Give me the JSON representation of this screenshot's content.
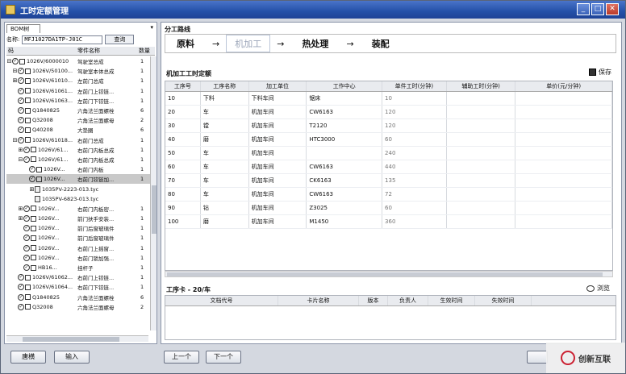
{
  "window": {
    "title": "工时定额管理"
  },
  "left": {
    "tab_label": "BOM树",
    "name_label": "名称:",
    "name_value": "MFJ1027DA1TP-J01C",
    "query_label": "查询",
    "col_code": "码",
    "col_name": "零件名称",
    "col_qty": "数量",
    "tree": [
      {
        "toggle": "⊟",
        "code": "1026V/6000010",
        "name": "驾驶室总成",
        "qty": "1",
        "indent": 0
      },
      {
        "toggle": "⊟",
        "code": "1026V/50100...",
        "name": "驾驶室本体总成",
        "qty": "1",
        "indent": 1
      },
      {
        "toggle": "⊞",
        "code": "1026V/61010...",
        "name": "左前门总成",
        "qty": "1",
        "indent": 1
      },
      {
        "toggle": "",
        "code": "1026V/61061...",
        "name": "左前门上铰链...",
        "qty": "1",
        "indent": 1
      },
      {
        "toggle": "",
        "code": "1026V/61063...",
        "name": "左前门下铰链...",
        "qty": "1",
        "indent": 1
      },
      {
        "toggle": "",
        "code": "Q1840825",
        "name": "六角法兰面螺栓",
        "qty": "6",
        "indent": 1
      },
      {
        "toggle": "",
        "code": "Q32008",
        "name": "六角法兰面螺母",
        "qty": "2",
        "indent": 1
      },
      {
        "toggle": "",
        "code": "Q40208",
        "name": "大垫圈",
        "qty": "6",
        "indent": 1
      },
      {
        "toggle": "⊟",
        "code": "1026V/61018...",
        "name": "右前门总成",
        "qty": "1",
        "indent": 1
      },
      {
        "toggle": "⊞",
        "code": "1026V/61...",
        "name": "右前门内板总成",
        "qty": "1",
        "indent": 2
      },
      {
        "toggle": "⊟",
        "code": "1026V/61...",
        "name": "右前门内板总成",
        "qty": "1",
        "indent": 2
      },
      {
        "toggle": "",
        "code": "1026V...",
        "name": "右前门内板",
        "qty": "1",
        "indent": 3
      },
      {
        "toggle": "",
        "code": "1026V...",
        "name": "右前门铰链加...",
        "qty": "1",
        "indent": 3,
        "selected": true
      },
      {
        "toggle": "⊞",
        "code": "1035PV-2223-013.tyc",
        "name": "",
        "qty": "",
        "indent": 4,
        "doc": true
      },
      {
        "toggle": "",
        "code": "1035PV-6823-013.tyc",
        "name": "",
        "qty": "",
        "indent": 4,
        "doc": true
      },
      {
        "toggle": "⊞",
        "code": "1026V...",
        "name": "右前门内板密...",
        "qty": "1",
        "indent": 2
      },
      {
        "toggle": "⊞",
        "code": "1026V...",
        "name": "前门扶手安装...",
        "qty": "1",
        "indent": 2
      },
      {
        "toggle": "",
        "code": "1026V...",
        "name": "前门后窗玻璃件",
        "qty": "1",
        "indent": 2
      },
      {
        "toggle": "",
        "code": "1026V...",
        "name": "前门后窗玻璃件",
        "qty": "1",
        "indent": 2
      },
      {
        "toggle": "",
        "code": "1026V...",
        "name": "右前门上摇窗...",
        "qty": "1",
        "indent": 2
      },
      {
        "toggle": "",
        "code": "1026V...",
        "name": "右前门锁加强...",
        "qty": "1",
        "indent": 2
      },
      {
        "toggle": "",
        "code": "HB16...",
        "name": "挂杆子",
        "qty": "1",
        "indent": 2
      },
      {
        "toggle": "",
        "code": "1026V/61062...",
        "name": "右前门上铰链...",
        "qty": "1",
        "indent": 1
      },
      {
        "toggle": "",
        "code": "1026V/61064...",
        "name": "右前门下铰链...",
        "qty": "1",
        "indent": 1
      },
      {
        "toggle": "",
        "code": "Q1840825",
        "name": "六角法兰面螺栓",
        "qty": "6",
        "indent": 1
      },
      {
        "toggle": "",
        "code": "Q32008",
        "name": "六角法兰面螺母",
        "qty": "2",
        "indent": 1
      }
    ]
  },
  "route": {
    "title": "分工路线",
    "steps": [
      "原料",
      "机加工",
      "热处理",
      "装配"
    ],
    "arrow": "→"
  },
  "machining": {
    "title": "机加工工时定额",
    "save_label": "保存",
    "columns": [
      "工序号",
      "工序名称",
      "加工单位",
      "工作中心",
      "单件工时(分钟)",
      "辅助工时(分钟)",
      "单价(元/分钟)"
    ],
    "rows": [
      [
        "10",
        "下料",
        "下料车间",
        "锯床",
        "10",
        "",
        ""
      ],
      [
        "20",
        "车",
        "机加车间",
        "CW6163",
        "120",
        "",
        ""
      ],
      [
        "30",
        "镗",
        "机加车间",
        "T2120",
        "120",
        "",
        ""
      ],
      [
        "40",
        "磨",
        "机加车间",
        "HTC3000",
        "60",
        "",
        ""
      ],
      [
        "50",
        "车",
        "机加车间",
        "",
        "240",
        "",
        ""
      ],
      [
        "60",
        "车",
        "机加车间",
        "CW6163",
        "440",
        "",
        ""
      ],
      [
        "70",
        "车",
        "机加车间",
        "CK6163",
        "135",
        "",
        ""
      ],
      [
        "80",
        "车",
        "机加车间",
        "CW6163",
        "72",
        "",
        ""
      ],
      [
        "90",
        "钻",
        "机加车间",
        "Z3025",
        "60",
        "",
        ""
      ],
      [
        "100",
        "磨",
        "机加车间",
        "M1450",
        "360",
        "",
        ""
      ]
    ]
  },
  "card": {
    "title": "工序卡 - 20/车",
    "preview_label": "浏览",
    "columns": [
      "文档代号",
      "卡片名称",
      "版本",
      "负责人",
      "生效时间",
      "失效时间"
    ]
  },
  "buttons": {
    "btn1": "唐横",
    "btn2": "输入",
    "prev": "上一个",
    "next": "下一个"
  },
  "watermark": {
    "text": "创新互联"
  }
}
